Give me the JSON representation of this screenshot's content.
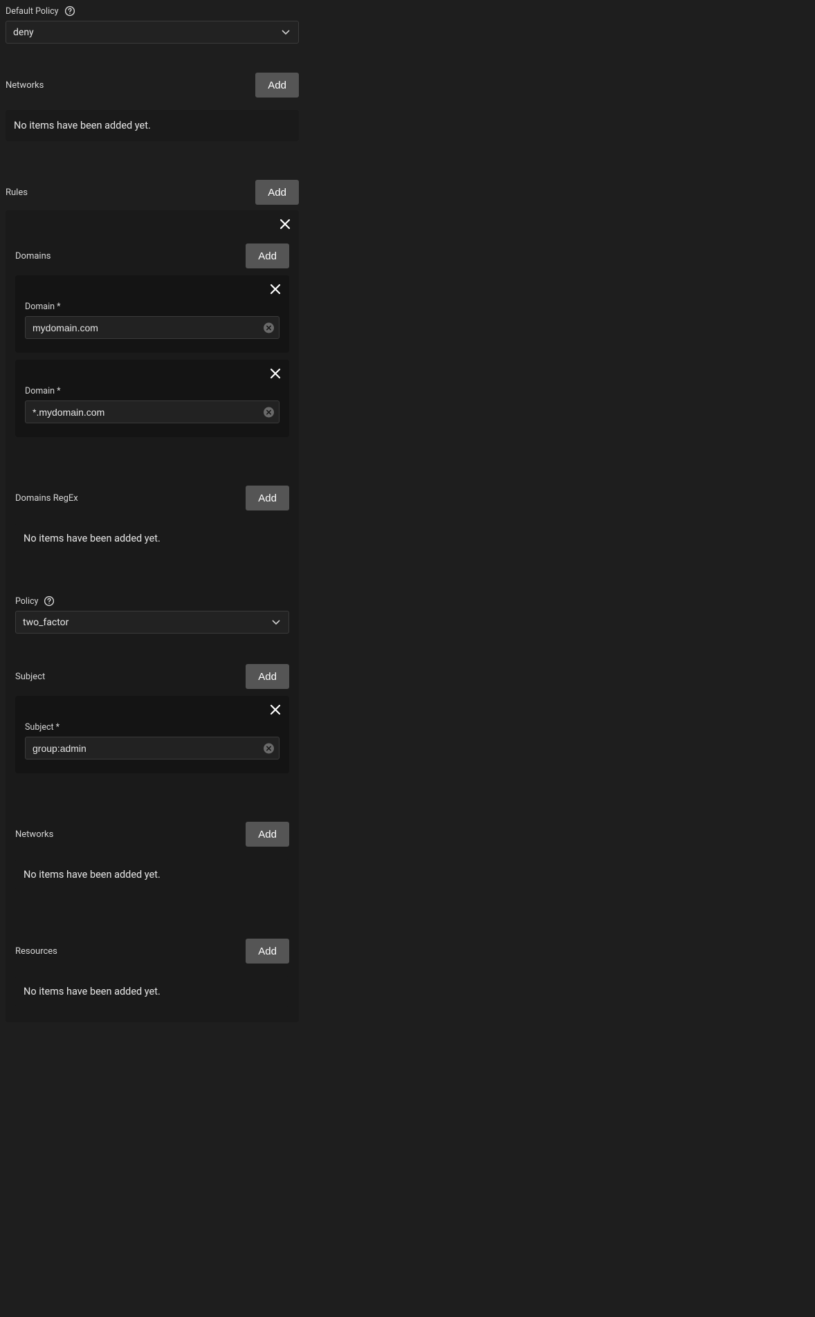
{
  "defaultPolicy": {
    "label": "Default Policy",
    "value": "deny"
  },
  "networks_outer": {
    "title": "Networks",
    "add": "Add",
    "empty": "No items have been added yet."
  },
  "rules": {
    "title": "Rules",
    "add": "Add",
    "rule0": {
      "domains": {
        "title": "Domains",
        "add": "Add",
        "items": [
          {
            "label": "Domain *",
            "value": "mydomain.com"
          },
          {
            "label": "Domain *",
            "value": "*.mydomain.com"
          }
        ]
      },
      "domains_regex": {
        "title": "Domains RegEx",
        "add": "Add",
        "empty": "No items have been added yet."
      },
      "policy": {
        "label": "Policy",
        "value": "two_factor"
      },
      "subject": {
        "title": "Subject",
        "add": "Add",
        "items": [
          {
            "label": "Subject *",
            "value": "group:admin"
          }
        ]
      },
      "networks": {
        "title": "Networks",
        "add": "Add",
        "empty": "No items have been added yet."
      },
      "resources": {
        "title": "Resources",
        "add": "Add",
        "empty": "No items have been added yet."
      }
    }
  }
}
